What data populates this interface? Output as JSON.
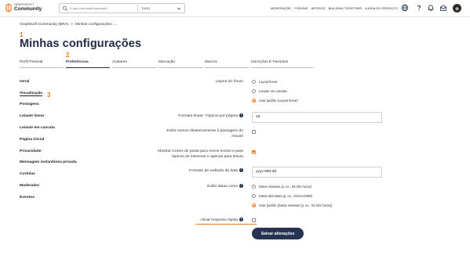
{
  "brand": {
    "line1": "GRAPHISOFT",
    "line2": "Community"
  },
  "search": {
    "placeholder": "O que você está buscando?",
    "scope": "TUDO"
  },
  "topnav": {
    "items": [
      "MODERAÇÃO",
      "FORUNS",
      "ARTIGOS",
      "BUILDING TOGETHER",
      "AJUDA DO PRODUTO"
    ]
  },
  "icons": {
    "globe": "globe-icon",
    "help": "help-icon",
    "bell": "bell-icon",
    "mail": "mail-icon",
    "avatar": "avatar"
  },
  "breadcrumb": {
    "items": [
      "Graphisoft Community (BRA)",
      ">",
      "Minhas configurações :..."
    ]
  },
  "annotations": {
    "n1": "1",
    "n2": "2",
    "n3": "3"
  },
  "page": {
    "title": "Minhas configurações"
  },
  "tabs": [
    {
      "label": "Perfil Pessoal"
    },
    {
      "label": "Preferências"
    },
    {
      "label": "Avatares"
    },
    {
      "label": "Marcação"
    },
    {
      "label": "Macros"
    },
    {
      "label": "Inscrições E Favoritos"
    }
  ],
  "sidebar": {
    "items": [
      "Geral",
      "Visualização",
      "Postagens",
      "Leiaute linear",
      "Leiaute em cascata",
      "Página inicial",
      "Privacidade",
      "Mensagem instantânea privada",
      "Curtidas",
      "Moderador",
      "Eventos"
    ]
  },
  "form": {
    "forum_layout": {
      "label": "Layout do fórum",
      "options": [
        "Layout linear",
        "Leiaute em cascata",
        "Usar padrão (Layout linear)"
      ],
      "selected": "Usar padrão (Layout linear)"
    },
    "topics_per_page": {
      "label": "Formato linear: Tópicos por página",
      "value": "15"
    },
    "hover_menus": {
      "label1": "Exibir menus dinamicamente à passagem do",
      "label2": "mouse",
      "checked": false
    },
    "folder_icons": {
      "label1": "Mostrar ícones de pasta para novos envios e para",
      "label2": "tópicos de interesse e apenas para leitura",
      "checked": true
    },
    "date_format": {
      "label": "Formato de exibição da data",
      "value": "yyyy-MM-dd"
    },
    "date_display": {
      "label": "Exibir datas como",
      "options": [
        "Datas relativas (p. ex., há três horas)",
        "Datas absolutas (p. ex., 15/nov/1968)",
        "Usar padrão (Datas relativas (p. ex., há três horas))"
      ],
      "selected": "Usar padrão (Datas relativas (p. ex., há três horas))"
    },
    "quick_reply": {
      "label": "Ativar resposta rápida",
      "checked": false
    },
    "save_label": "Salvar alterações"
  },
  "colors": {
    "accent": "#f07a1a",
    "primary": "#263352",
    "title": "#1f2a44"
  }
}
